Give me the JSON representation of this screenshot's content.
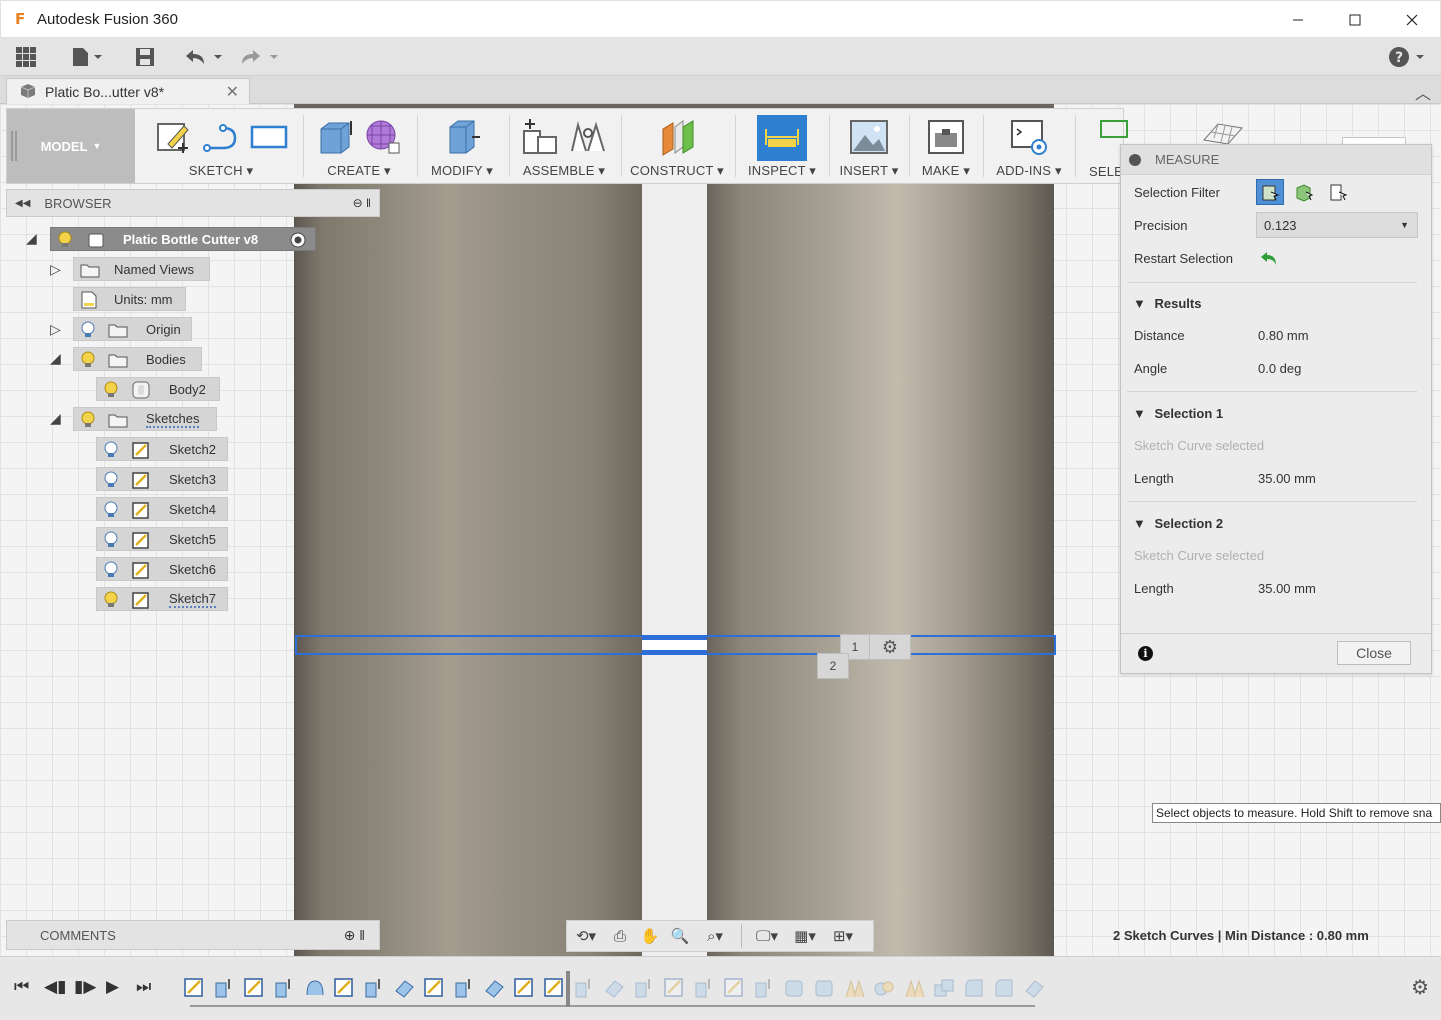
{
  "window": {
    "title": "Autodesk Fusion 360",
    "logo_letter": "F",
    "controls": [
      "minimize-icon",
      "maximize-icon",
      "close-icon"
    ]
  },
  "document_tab": {
    "label": "Platic Bo...utter v8*"
  },
  "toolbar": {
    "model_label": "MODEL",
    "groups": [
      {
        "label": "SKETCH ▾"
      },
      {
        "label": "CREATE ▾"
      },
      {
        "label": "MODIFY ▾"
      },
      {
        "label": "ASSEMBLE ▾"
      },
      {
        "label": "CONSTRUCT ▾"
      },
      {
        "label": "INSPECT ▾"
      },
      {
        "label": "INSERT ▾"
      },
      {
        "label": "MAKE ▾"
      },
      {
        "label": "ADD-INS ▾"
      },
      {
        "label": "SELE"
      }
    ]
  },
  "browser": {
    "title": "BROWSER",
    "root": "Platic Bottle Cutter v8",
    "items": [
      {
        "label": "Named Views"
      },
      {
        "label": "Units: mm"
      },
      {
        "label": "Origin"
      },
      {
        "label": "Bodies"
      },
      {
        "label": "Body2"
      },
      {
        "label": "Sketches"
      },
      {
        "label": "Sketch2"
      },
      {
        "label": "Sketch3"
      },
      {
        "label": "Sketch4"
      },
      {
        "label": "Sketch5"
      },
      {
        "label": "Sketch6"
      },
      {
        "label": "Sketch7"
      }
    ]
  },
  "comments": {
    "title": "COMMENTS"
  },
  "canvas": {
    "tag1": "1",
    "tag2": "2",
    "status": "2 Sketch Curves | Min Distance : 0.80 mm",
    "tooltip": "Select objects to measure. Hold Shift to remove sna"
  },
  "measure": {
    "title": "MEASURE",
    "selection_filter_label": "Selection Filter",
    "precision_label": "Precision",
    "precision_value": "0.123",
    "restart_label": "Restart Selection",
    "results_title": "Results",
    "distance_label": "Distance",
    "distance_value": "0.80 mm",
    "angle_label": "Angle",
    "angle_value": "0.0 deg",
    "sel1_title": "Selection 1",
    "sel1_desc": "Sketch Curve selected",
    "sel1_length_label": "Length",
    "sel1_length_value": "35.00 mm",
    "sel2_title": "Selection 2",
    "sel2_desc": "Sketch Curve selected",
    "sel2_length_label": "Length",
    "sel2_length_value": "35.00 mm",
    "close_label": "Close"
  },
  "colors": {
    "accent_blue": "#2e7fd0",
    "selection_blue": "#2d6fd6",
    "bulb_yellow": "#f3d34a"
  }
}
